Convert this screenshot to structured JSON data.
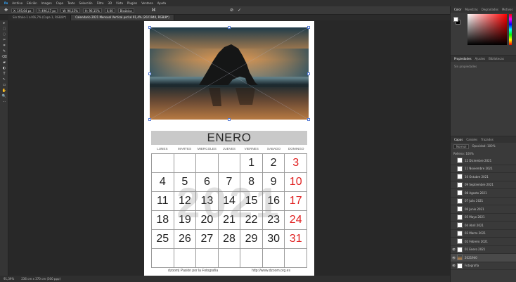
{
  "menu": [
    "Archivo",
    "Edición",
    "Imagen",
    "Capa",
    "Texto",
    "Selección",
    "Filtro",
    "3D",
    "Vista",
    "Plugins",
    "Ventana",
    "Ayuda"
  ],
  "options": {
    "x": "X: 195,64 px",
    "y": "Y: 496,17 px",
    "w": "W: 96,15%",
    "h": "H: 96,15%",
    "angle": "0,00",
    "interp": "Bicúbica"
  },
  "tabs": [
    {
      "label": "Sin título-1 al 66,7% (Capa 1, RGB/8*)",
      "active": false
    },
    {
      "label": "Calendario 2021 Mensual Vertical.psd al 91,4% (2021940, RGB/8*)",
      "active": true
    }
  ],
  "tools": [
    "▸",
    "⬚",
    "◌",
    "✂",
    "⌗",
    "✎",
    "⌫",
    "▰",
    "◐",
    "T",
    "↖",
    "▭",
    "✋",
    "🔍",
    "⋯"
  ],
  "document": {
    "month": "ENERO",
    "weekdays": [
      "LUNES",
      "MARTES",
      "MIERCOLES",
      "JUEVES",
      "VIERNES",
      "SABADO",
      "DOMINGO"
    ],
    "weeks": [
      [
        "",
        "",
        "",
        "",
        "1",
        "2",
        "3"
      ],
      [
        "4",
        "5",
        "6",
        "7",
        "8",
        "9",
        "10"
      ],
      [
        "11",
        "12",
        "13",
        "14",
        "15",
        "16",
        "17"
      ],
      [
        "18",
        "19",
        "20",
        "21",
        "22",
        "23",
        "24"
      ],
      [
        "25",
        "26",
        "27",
        "28",
        "29",
        "30",
        "31"
      ],
      [
        "",
        "",
        "",
        "",
        "",
        "",
        ""
      ]
    ],
    "watermark": "2021",
    "footer_left": "dzoom| Pasión por la Fotografía",
    "footer_right": "http://www.dzoom.org.es"
  },
  "status": {
    "zoom": "91,39%",
    "doc": "236 cm x 370 cm (300 ppp)"
  },
  "panels": {
    "color_tabs": [
      "Color",
      "Muestras",
      "Degradados",
      "Motivos"
    ],
    "props_tabs": [
      "Propiedades",
      "Ajustes",
      "Bibliotecas"
    ],
    "props_text": "Sin propiedades",
    "layers_tabs": [
      "Capas",
      "Canales",
      "Trazados"
    ],
    "blend": "Normal",
    "opacity": "Opacidad: 100%",
    "fill": "Relleno: 100%",
    "layers": [
      {
        "name": "12 Diciembre 2021",
        "visible": false,
        "hl": false,
        "img": false
      },
      {
        "name": "11 Noviembre 2021",
        "visible": false,
        "hl": false,
        "img": false
      },
      {
        "name": "10 Octubre 2021",
        "visible": false,
        "hl": false,
        "img": false
      },
      {
        "name": "09 Septiembre 2021",
        "visible": false,
        "hl": false,
        "img": false
      },
      {
        "name": "08 Agosto 2021",
        "visible": false,
        "hl": false,
        "img": false
      },
      {
        "name": "07 Julio 2021",
        "visible": false,
        "hl": false,
        "img": false
      },
      {
        "name": "06 Junio 2021",
        "visible": false,
        "hl": false,
        "img": false
      },
      {
        "name": "05 Mayo 2021",
        "visible": false,
        "hl": false,
        "img": false
      },
      {
        "name": "04 Abril 2021",
        "visible": false,
        "hl": false,
        "img": false
      },
      {
        "name": "03 Marzo 2021",
        "visible": false,
        "hl": false,
        "img": false
      },
      {
        "name": "02 Febrero 2021",
        "visible": false,
        "hl": false,
        "img": false
      },
      {
        "name": "01 Enero 2021",
        "visible": true,
        "hl": false,
        "img": false
      },
      {
        "name": "2021940",
        "visible": true,
        "hl": true,
        "img": true
      },
      {
        "name": "Fotografía",
        "visible": true,
        "hl": false,
        "img": false
      }
    ]
  }
}
